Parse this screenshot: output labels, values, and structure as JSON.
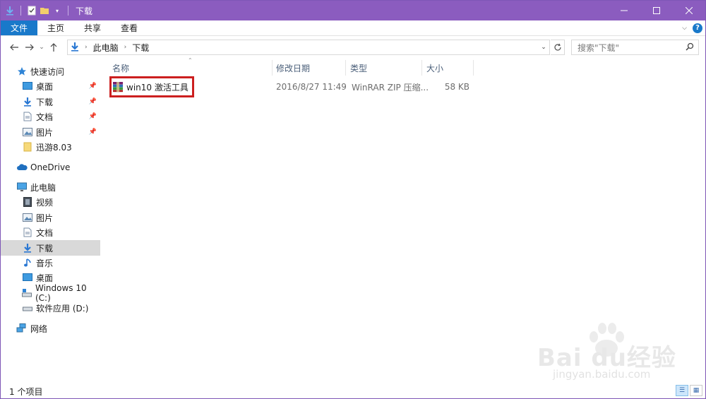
{
  "window": {
    "title": "下载",
    "controls": [
      "minimize",
      "maximize",
      "close"
    ]
  },
  "ribbon": {
    "tabs": [
      {
        "label": "文件",
        "active": true
      },
      {
        "label": "主页",
        "active": false
      },
      {
        "label": "共享",
        "active": false
      },
      {
        "label": "查看",
        "active": false
      }
    ]
  },
  "address": {
    "breadcrumbs": [
      "此电脑",
      "下载"
    ],
    "search_placeholder": "搜索\"下载\""
  },
  "nav": {
    "quick_access": "快速访问",
    "quick_items": [
      "桌面",
      "下载",
      "文档",
      "图片",
      "迅游8.03"
    ],
    "onedrive": "OneDrive",
    "this_pc": "此电脑",
    "pc_items": [
      "视频",
      "图片",
      "文档",
      "下载",
      "音乐",
      "桌面",
      "Windows 10 (C:)",
      "软件应用 (D:)"
    ],
    "network": "网络",
    "selected": "下载"
  },
  "columns": {
    "name": "名称",
    "date": "修改日期",
    "type": "类型",
    "size": "大小"
  },
  "files": [
    {
      "name": "win10 激活工具",
      "date": "2016/8/27 11:49",
      "type": "WinRAR ZIP 压缩...",
      "size": "58 KB",
      "icon": "winrar-archive-icon"
    }
  ],
  "status": {
    "item_count": "1 个项目"
  },
  "watermark": {
    "main": "Bai du经验",
    "sub": "jingyan.baidu.com"
  },
  "colors": {
    "titlebar": "#8b5cbf",
    "accent": "#1979ca",
    "highlight": "#cc1f1f"
  }
}
